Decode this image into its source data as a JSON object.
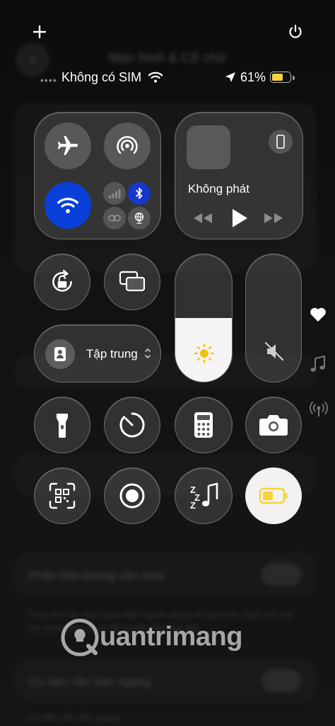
{
  "background_page": {
    "title": "Màn hình & Cỡ chữ",
    "rows": [
      {
        "label": "Phân biệt không cần màu",
        "description": "Thay thế các mục giao diện người dùng chỉ dựa trên màu với các lựa chọn khác nhau để truyền đạt thay thế."
      },
      {
        "label": "Ưu tiên văn bản ngang",
        "description": "Ưu tiên văn bản ngang"
      }
    ]
  },
  "status_bar": {
    "carrier": "Không có SIM",
    "battery_percent": "61%",
    "battery_level": 0.61
  },
  "control_center": {
    "media": {
      "label": "Không phát"
    },
    "focus": {
      "label": "Tập trung"
    },
    "brightness_level": 0.5,
    "volume_level": 0.0
  },
  "watermark": {
    "text": "uantrimang"
  },
  "colors": {
    "wifi_active": "#0a3fd9",
    "bluetooth_active": "#1538c8",
    "battery_yellow": "#f6d43a",
    "low_power_bg": "#f2f2f2"
  }
}
